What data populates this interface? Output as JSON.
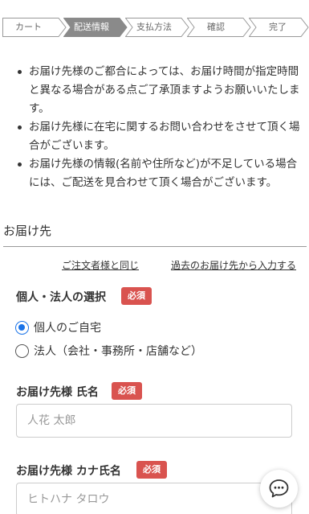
{
  "steps": [
    {
      "label": "カート",
      "active": false
    },
    {
      "label": "配送情報",
      "active": true
    },
    {
      "label": "支払方法",
      "active": false
    },
    {
      "label": "確認",
      "active": false
    },
    {
      "label": "完了",
      "active": false
    }
  ],
  "notes": [
    "お届け先様のご都合によっては、お届け時間が指定時間と異なる場合がある点ご了承頂ますようお願いいたします。",
    "お届け先様に在宅に関するお問い合わせをさせて頂く場合がございます。",
    "お届け先様の情報(名前や住所など)が不足している場合には、ご配送を見合わせて頂く場合がございます。"
  ],
  "section": {
    "title": "お届け先"
  },
  "links": {
    "same_as_orderer": "ご注文者様と同じ",
    "from_past": "過去のお届け先から入力する"
  },
  "form": {
    "type_label": "個人・法人の選択",
    "required": "必須",
    "options": [
      "個人のご自宅",
      "法人（会社・事務所・店舗など）"
    ],
    "selected_option": "個人のご自宅",
    "name_label": "お届け先様 氏名",
    "name_placeholder": "人花 太郎",
    "kana_label": "お届け先様 カナ氏名",
    "kana_placeholder": "ヒトハナ タロウ"
  },
  "colors": {
    "active_step": "#8a8a8a",
    "required_badge": "#d9534f",
    "radio_accent": "#1a73e8"
  },
  "icons": {
    "chat": "chat-bubble-icon"
  }
}
